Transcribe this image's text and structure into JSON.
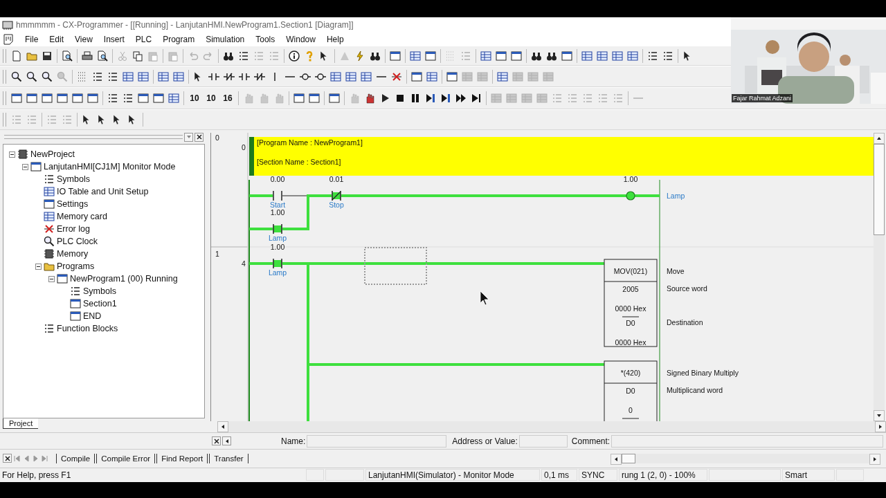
{
  "window": {
    "title": "hmmmmm - CX-Programmer - [[Running] - LanjutanHMI.NewProgram1.Section1 [Diagram]]"
  },
  "menu": [
    "File",
    "Edit",
    "View",
    "Insert",
    "PLC",
    "Program",
    "Simulation",
    "Tools",
    "Window",
    "Help"
  ],
  "toolbar_numbers": [
    "10",
    "10",
    "16"
  ],
  "tree": [
    {
      "label": "NewProject",
      "expanded": true,
      "children": [
        {
          "label": "LanjutanHMI[CJ1M] Monitor Mode",
          "expanded": true,
          "children": [
            {
              "label": "Symbols"
            },
            {
              "label": "IO Table and Unit Setup"
            },
            {
              "label": "Settings"
            },
            {
              "label": "Memory card"
            },
            {
              "label": "Error log"
            },
            {
              "label": "PLC Clock"
            },
            {
              "label": "Memory"
            },
            {
              "label": "Programs",
              "expanded": true,
              "children": [
                {
                  "label": "NewProgram1 (00) Running",
                  "expanded": true,
                  "children": [
                    {
                      "label": "Symbols"
                    },
                    {
                      "label": "Section1"
                    },
                    {
                      "label": "END"
                    }
                  ]
                }
              ]
            },
            {
              "label": "Function Blocks"
            }
          ]
        }
      ]
    }
  ],
  "project_tab": {
    "label": "Project",
    "selected": true
  },
  "header": {
    "program_name": "[Program Name : NewProgram1]",
    "section_name": "[Section Name : Section1]"
  },
  "rungs": [
    {
      "number": "0",
      "step": "0",
      "elements": [
        {
          "kind": "contact",
          "address": "0.00",
          "label": "Start",
          "on": false
        },
        {
          "kind": "contact",
          "address": "1.00",
          "label": "Lamp",
          "on": true
        },
        {
          "kind": "nc_contact",
          "address": "0.01",
          "label": "Stop",
          "on": true
        },
        {
          "kind": "coil",
          "address": "1.00",
          "label": "Lamp",
          "on": true
        }
      ]
    },
    {
      "number": "1",
      "step": "4",
      "elements": [
        {
          "kind": "contact",
          "address": "1.00",
          "label": "Lamp",
          "on": true
        },
        {
          "kind": "instruction",
          "name": "MOV(021)",
          "on": true,
          "operands": [
            "2005",
            "0000 Hex",
            "D0",
            "0000 Hex"
          ],
          "comments": [
            "Move",
            "Source word",
            "Destination"
          ]
        },
        {
          "kind": "instruction",
          "name": "*(420)",
          "on": true,
          "operands": [
            "D0",
            "0"
          ],
          "comments": [
            "Signed Binary Multiply",
            "Multiplicand word"
          ]
        }
      ]
    }
  ],
  "fields": [
    {
      "label": "Name:"
    },
    {
      "label": "Address or Value:"
    },
    {
      "label": "Comment:"
    }
  ],
  "output_tabs": [
    {
      "label": "Compile",
      "selected": false
    },
    {
      "label": "Compile Error",
      "selected": false
    },
    {
      "label": "Find Report",
      "selected": false
    },
    {
      "label": "Transfer",
      "selected": false
    }
  ],
  "status_bar": [
    "For Help, press F1",
    "LanjutanHMI(Simulator) - Monitor Mode",
    "0,1 ms",
    "SYNC",
    "rung 1 (2, 0)  - 100%",
    "Smart"
  ],
  "video": {
    "name": "Fajar Rahmat Adzani"
  }
}
